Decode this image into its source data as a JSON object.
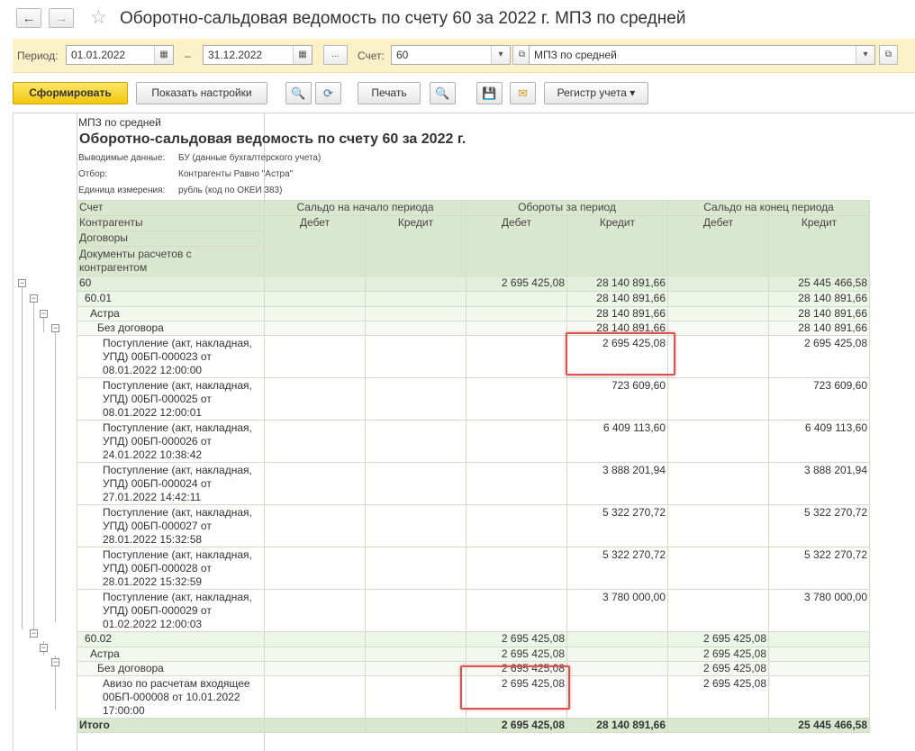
{
  "window": {
    "title": "Оборотно-сальдовая ведомость по счету 60 за 2022 г. МПЗ по средней",
    "back_icon": "←",
    "forward_icon": "→",
    "favorite_icon": "☆"
  },
  "params": {
    "period_label": "Период:",
    "date_from": "01.01.2022",
    "dash": "–",
    "date_to": "31.12.2022",
    "ellipsis": "...",
    "account_label": "Счет:",
    "account": "60",
    "org": "МПЗ по средней",
    "calendar_icon": "▦",
    "dropdown_icon": "▾",
    "open_icon": "⧉"
  },
  "toolbar": {
    "generate": "Сформировать",
    "show_settings": "Показать настройки",
    "search_icon": "🔍",
    "search_next_icon": "⟳",
    "print": "Печать",
    "preview_icon": "🔍",
    "save_icon": "💾",
    "mail_icon": "✉",
    "register": "Регистр учета",
    "register_arrow": "▾"
  },
  "report": {
    "org": "МПЗ по средней",
    "title": "Оборотно-сальдовая ведомость по счету 60 за 2022 г.",
    "meta": [
      {
        "label": "Выводимые данные:",
        "value": "БУ (данные бухгалтерского учета)"
      },
      {
        "label": "Отбор:",
        "value": "Контрагенты Равно \"Астра\""
      },
      {
        "label": "Единица измерения:",
        "value": "рубль (код по ОКЕИ 383)"
      }
    ],
    "headers": {
      "col1": [
        "Счет",
        "Контрагенты",
        "Договоры",
        "Документы расчетов с контрагентом"
      ],
      "opening": "Сальдо на начало периода",
      "turnover": "Обороты за период",
      "closing": "Сальдо на конец периода",
      "debit": "Дебет",
      "credit": "Кредит"
    },
    "rows": [
      {
        "label": "60",
        "ob_d": "",
        "ob_c": "",
        "t_d": "2 695 425,08",
        "t_c": "28 140 891,66",
        "cl_d": "",
        "cl_c": "25 445 466,58"
      },
      {
        "label": "60.01",
        "ob_d": "",
        "ob_c": "",
        "t_d": "",
        "t_c": "28 140 891,66",
        "cl_d": "",
        "cl_c": "28 140 891,66"
      },
      {
        "label": "Астра",
        "ob_d": "",
        "ob_c": "",
        "t_d": "",
        "t_c": "28 140 891,66",
        "cl_d": "",
        "cl_c": "28 140 891,66"
      },
      {
        "label": "Без договора",
        "ob_d": "",
        "ob_c": "",
        "t_d": "",
        "t_c": "28 140 891,66",
        "cl_d": "",
        "cl_c": "28 140 891,66"
      },
      {
        "label": "Поступление (акт, накладная, УПД) 00БП-000023 от 08.01.2022 12:00:00",
        "ob_d": "",
        "ob_c": "",
        "t_d": "",
        "t_c": "2 695 425,08",
        "cl_d": "",
        "cl_c": "2 695 425,08"
      },
      {
        "label": "Поступление (акт, накладная, УПД) 00БП-000025 от 08.01.2022 12:00:01",
        "ob_d": "",
        "ob_c": "",
        "t_d": "",
        "t_c": "723 609,60",
        "cl_d": "",
        "cl_c": "723 609,60"
      },
      {
        "label": "Поступление (акт, накладная, УПД) 00БП-000026 от 24.01.2022 10:38:42",
        "ob_d": "",
        "ob_c": "",
        "t_d": "",
        "t_c": "6 409 113,60",
        "cl_d": "",
        "cl_c": "6 409 113,60"
      },
      {
        "label": "Поступление (акт, накладная, УПД) 00БП-000024 от 27.01.2022 14:42:11",
        "ob_d": "",
        "ob_c": "",
        "t_d": "",
        "t_c": "3 888 201,94",
        "cl_d": "",
        "cl_c": "3 888 201,94"
      },
      {
        "label": "Поступление (акт, накладная, УПД) 00БП-000027 от 28.01.2022 15:32:58",
        "ob_d": "",
        "ob_c": "",
        "t_d": "",
        "t_c": "5 322 270,72",
        "cl_d": "",
        "cl_c": "5 322 270,72"
      },
      {
        "label": "Поступление (акт, накладная, УПД) 00БП-000028 от 28.01.2022 15:32:59",
        "ob_d": "",
        "ob_c": "",
        "t_d": "",
        "t_c": "5 322 270,72",
        "cl_d": "",
        "cl_c": "5 322 270,72"
      },
      {
        "label": "Поступление (акт, накладная, УПД) 00БП-000029 от 01.02.2022 12:00:03",
        "ob_d": "",
        "ob_c": "",
        "t_d": "",
        "t_c": "3 780 000,00",
        "cl_d": "",
        "cl_c": "3 780 000,00"
      },
      {
        "label": "60.02",
        "ob_d": "",
        "ob_c": "",
        "t_d": "2 695 425,08",
        "t_c": "",
        "cl_d": "2 695 425,08",
        "cl_c": ""
      },
      {
        "label": "Астра",
        "ob_d": "",
        "ob_c": "",
        "t_d": "2 695 425,08",
        "t_c": "",
        "cl_d": "2 695 425,08",
        "cl_c": ""
      },
      {
        "label": "Без договора",
        "ob_d": "",
        "ob_c": "",
        "t_d": "2 695 425,08",
        "t_c": "",
        "cl_d": "2 695 425,08",
        "cl_c": ""
      },
      {
        "label": "Авизо по расчетам входящее 00БП-000008 от 10.01.2022 17:00:00",
        "ob_d": "",
        "ob_c": "",
        "t_d": "2 695 425,08",
        "t_c": "",
        "cl_d": "2 695 425,08",
        "cl_c": ""
      }
    ],
    "total": {
      "label": "Итого",
      "ob_d": "",
      "ob_c": "",
      "t_d": "2 695 425,08",
      "t_c": "28 140 891,66",
      "cl_d": "",
      "cl_c": "25 445 466,58"
    },
    "collapse_icon": "−",
    "highlight_color": "#e05050"
  }
}
